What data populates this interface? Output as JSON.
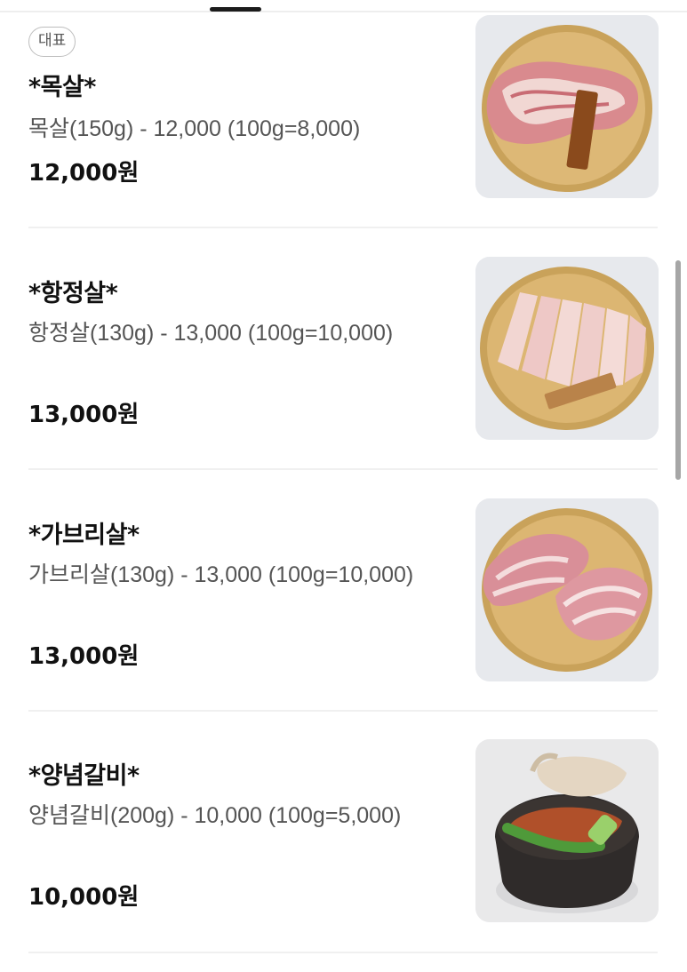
{
  "menu": {
    "items": [
      {
        "badge": "대표",
        "name": "*목살*",
        "description": "목살(150g) - 12,000 (100g=8,000)",
        "price": "12,000원",
        "image": "pork-neck-on-brass-plate"
      },
      {
        "badge": "",
        "name": "*항정살*",
        "description": "항정살(130g) - 13,000 (100g=10,000)",
        "price": "13,000원",
        "image": "pork-jowl-slices-on-brass-plate"
      },
      {
        "badge": "",
        "name": "*가브리살*",
        "description": "가브리살(130g) - 13,000 (100g=10,000)",
        "price": "13,000원",
        "image": "pork-shoulder-strips-on-brass-plate"
      },
      {
        "badge": "",
        "name": "*양념갈비*",
        "description": "양념갈비(200g) - 10,000 (100g=5,000)",
        "price": "10,000원",
        "image": "marinated-ribs-in-clay-pot"
      }
    ]
  }
}
